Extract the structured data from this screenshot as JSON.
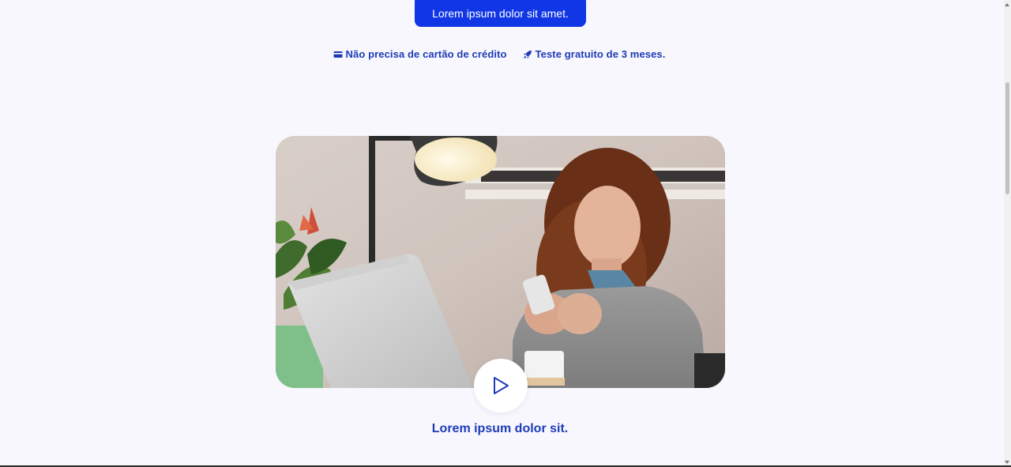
{
  "cta": {
    "label": "Lorem ipsum dolor sit amet."
  },
  "features": [
    {
      "icon": "credit-card-icon",
      "text": "Não precisa de cartão de crédito"
    },
    {
      "icon": "rocket-icon",
      "text": "Teste gratuito de 3 meses."
    }
  ],
  "video": {
    "caption": "Lorem ipsum dolor sit.",
    "play_icon": "play-icon"
  },
  "colors": {
    "background": "#f8f7fe",
    "accent": "#1136e6",
    "text_accent": "#1d3bb7"
  }
}
